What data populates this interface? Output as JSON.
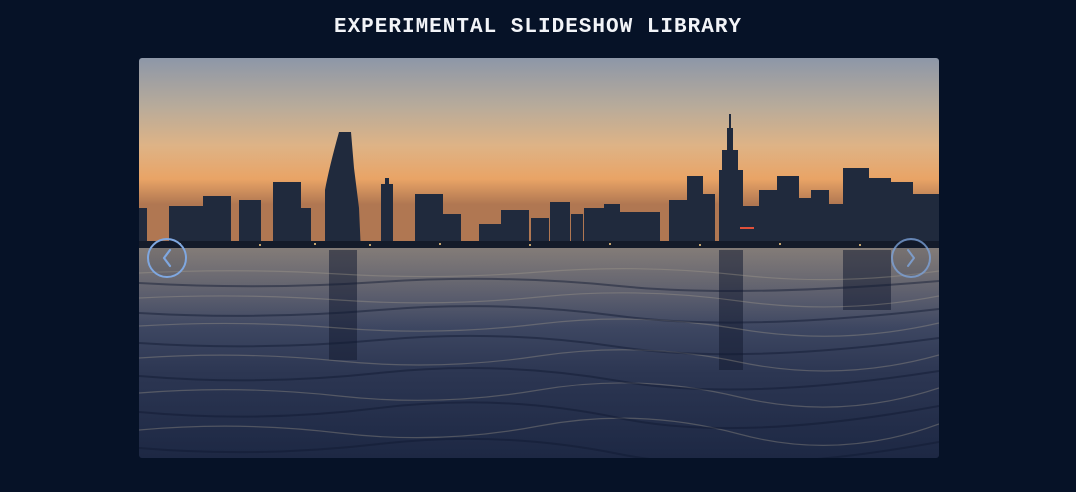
{
  "header": {
    "title": "EXPERIMENTAL SLIDESHOW LIBRARY"
  },
  "slideshow": {
    "current_slide": {
      "alt": "City skyline at dusk reflected over lake water"
    },
    "prev_icon": "chevron-left-icon",
    "next_icon": "chevron-right-icon"
  },
  "colors": {
    "background": "#061227",
    "title_text": "#f2f4f8",
    "arrow_accent": "#7fa7e0"
  }
}
